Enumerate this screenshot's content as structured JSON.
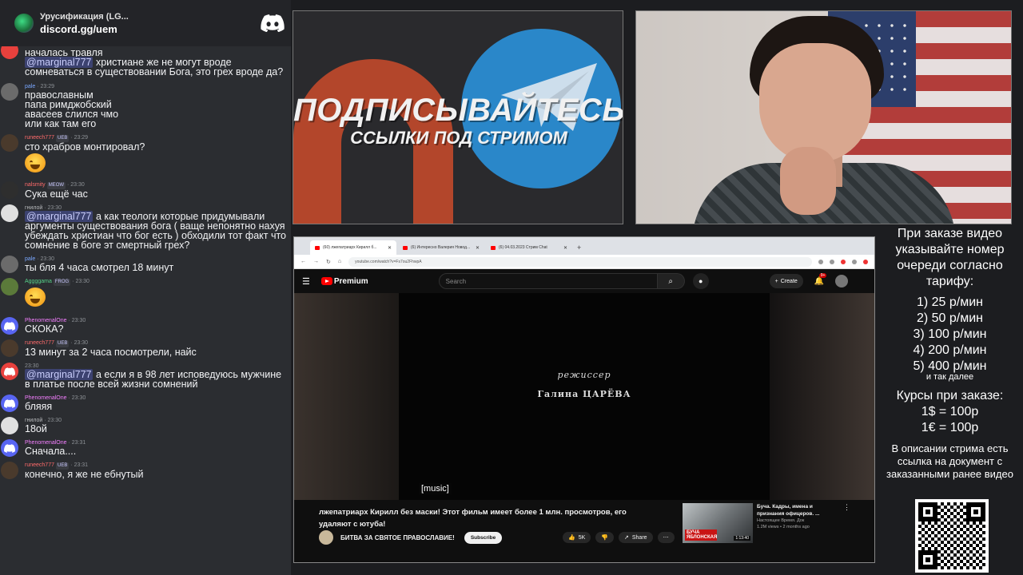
{
  "chat": {
    "server_name": "Урусификация (LG...",
    "invite_link": "discord.gg/uem",
    "messages": [
      {
        "user": "",
        "time": "",
        "text_mention": "",
        "text": "началась травля",
        "avatar": "red"
      },
      {
        "user": "",
        "time": "",
        "text_mention": "@marginal777",
        "text": " христиане же не могут вроде сомневаться в существовании Бога, это грех вроде да?",
        "avatar": ""
      },
      {
        "user": "pale",
        "time": "23:29",
        "text_mention": "",
        "text": "православным\nпапа римджобский\nавасеев слился чмо\nили как там его",
        "avatar": "photo"
      },
      {
        "user": "runeech777",
        "time": "23:29",
        "badge": "UEB",
        "text_mention": "",
        "text": "сто храбров монтировал?",
        "emoji": true,
        "avatar": "photo"
      },
      {
        "user": "nalsmity",
        "time": "23:30",
        "badge": "MEOW",
        "text_mention": "",
        "text": "Сука ещё час",
        "avatar": "photo"
      },
      {
        "user": "гнилой",
        "time": "23:30",
        "text_mention": "@marginal777",
        "text": " а как теологи которые придумывали аргументы существования бога ( ваще непонятно нахуя убеждать христиан что бог есть ) обходили тот факт что сомнение в боге эт смертный грех?",
        "avatar": "photo"
      },
      {
        "user": "pale",
        "time": "23:30",
        "text_mention": "",
        "text": "ты бля 4 часа смотрел 18 минут",
        "avatar": "photo"
      },
      {
        "user": "Aggggama",
        "time": "23:30",
        "badge": "FROG",
        "text_mention": "",
        "text": "",
        "emoji": true,
        "avatar": "photo"
      },
      {
        "user": "PhenomenalOne",
        "time": "23:30",
        "text_mention": "",
        "text": "СКОКА?",
        "avatar": "discord"
      },
      {
        "user": "runeech777",
        "time": "23:30",
        "badge": "UEB",
        "text_mention": "",
        "text": "13 минут за 2 часа посмотрели, найс",
        "avatar": "photo"
      },
      {
        "user": "",
        "time": "23:30",
        "text_mention": "@marginal777",
        "text": " а если я в 98 лет исповедуюсь мужчине в платье после всей жизни сомнений",
        "avatar": "red"
      },
      {
        "user": "PhenomenalOne",
        "time": "23:30",
        "text_mention": "",
        "text": "бляяя",
        "avatar": "discord"
      },
      {
        "user": "гнилой",
        "time": "23:30",
        "text_mention": "",
        "text": "18ой",
        "avatar": "photo"
      },
      {
        "user": "PhenomenalOne",
        "time": "23:31",
        "text_mention": "",
        "text": "Сначала....",
        "avatar": "discord"
      },
      {
        "user": "runeech777",
        "time": "23:31",
        "badge": "UEB",
        "text_mention": "",
        "text": "конечно, я же не ебнутый",
        "avatar": "photo"
      }
    ]
  },
  "promo": {
    "title": "ПОДПИСЫВАЙТЕСЬ",
    "subtitle": "ССЫЛКИ ПОД СТРИМОМ"
  },
  "browser": {
    "tabs": [
      "(60) лжепатриарх Кирилл б...",
      "(6) Интересно Валерия Новод...",
      "(6) 04.03.2023 Стрим Chat"
    ],
    "url": "youtube.com/watch?v=Fs7ou2FhwpA",
    "search_placeholder": "Search",
    "logo_text": "Premium",
    "create_label": "Create",
    "notif_count": "9+",
    "credit_role": "режиссер",
    "credit_name": "Галина ЦАРЁВА",
    "caption": "[music]",
    "video_title": "лжепатриарх Кирилл без маски! Этот фильм имеет более 1 млн. просмотров, его удаляют с ютуба!",
    "channel_name": "БИТВА ЗА СВЯТОЕ ПРАВОСЛАВИЕ!",
    "subscribe_label": "Subscribe",
    "likes": "5K",
    "share_label": "Share",
    "related": {
      "title": "Буча. Кадры, имена и признания офицеров. ...",
      "channel": "Настоящее Время. Док",
      "meta": "1.2M views • 2 months ago",
      "thumb_label": "БУЧА ЯБЛОНСКАЯ",
      "duration": "1:13:40"
    }
  },
  "side": {
    "order_head": "При заказе видео указывайте номер очереди согласно тарифу:",
    "tariffs": [
      "1) 25 р/мин",
      "2) 50 р/мин",
      "3) 100 р/мин",
      "4) 200 р/мин",
      "5) 400 р/мин"
    ],
    "tariff_note": "и так далее",
    "rates_head": "Курсы при заказе:",
    "rates": [
      "1$ = 100р",
      "1€ = 100р"
    ],
    "desc": "В описании стрима есть ссылка на документ с заказанными ранее видео"
  }
}
